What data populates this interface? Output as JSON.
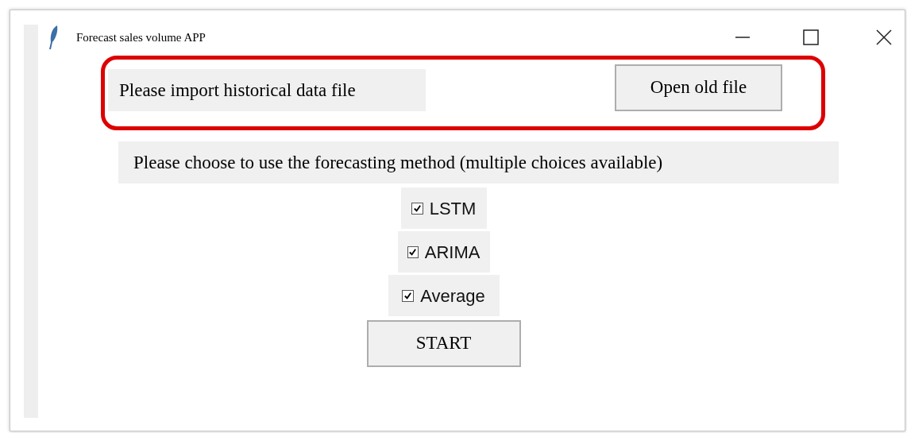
{
  "window": {
    "title": "Forecast sales volume APP"
  },
  "import": {
    "label": "Please import historical data file",
    "button": "Open old file"
  },
  "method": {
    "label": "Please choose to use the forecasting method (multiple choices available)"
  },
  "options": [
    {
      "label": "LSTM",
      "checked": true
    },
    {
      "label": "ARIMA",
      "checked": true
    },
    {
      "label": "Average",
      "checked": true
    }
  ],
  "buttons": [
    "START"
  ]
}
